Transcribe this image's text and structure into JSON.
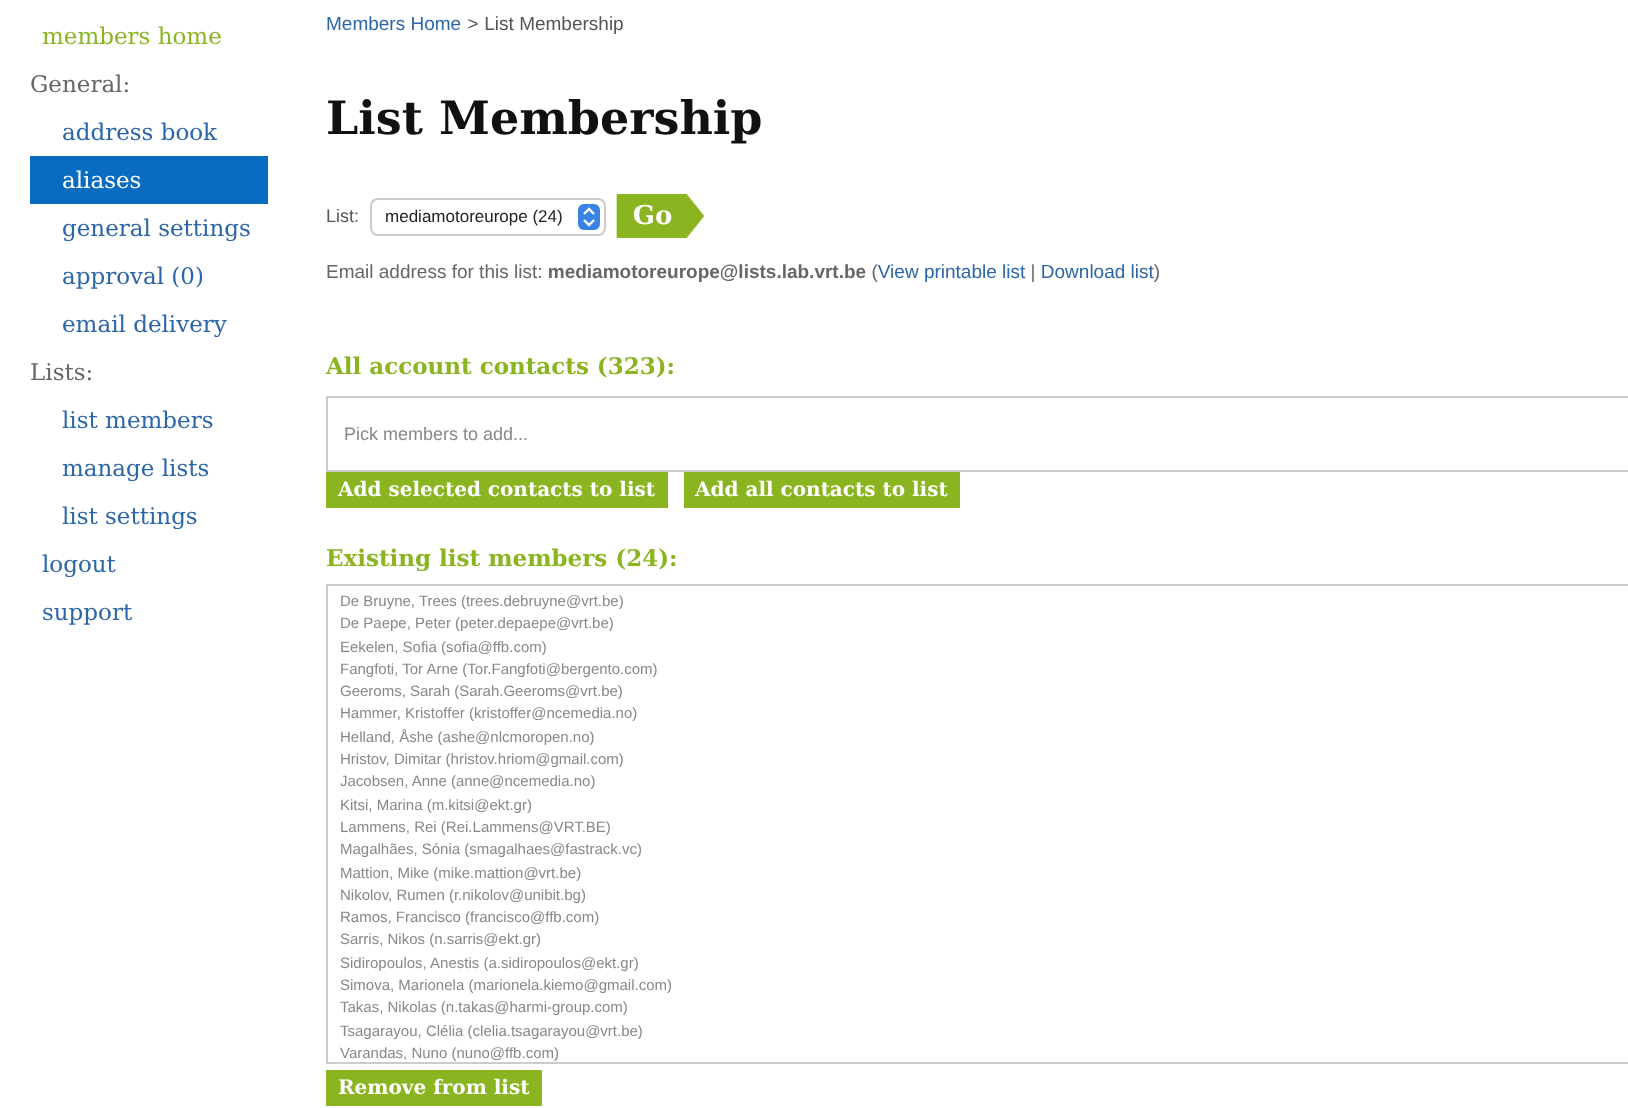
{
  "sidebar": {
    "items": [
      {
        "label": "members home",
        "kind": "home",
        "selected": false
      },
      {
        "label": "General:",
        "kind": "heading",
        "selected": false
      },
      {
        "label": "address book",
        "kind": "sub",
        "selected": false
      },
      {
        "label": "aliases",
        "kind": "sub",
        "selected": true
      },
      {
        "label": "general settings",
        "kind": "sub",
        "selected": false
      },
      {
        "label": "approval (0)",
        "kind": "sub",
        "selected": false
      },
      {
        "label": "email delivery",
        "kind": "sub",
        "selected": false
      },
      {
        "label": "Lists:",
        "kind": "heading",
        "selected": false
      },
      {
        "label": "list members",
        "kind": "sub",
        "selected": false
      },
      {
        "label": "manage lists",
        "kind": "sub",
        "selected": false
      },
      {
        "label": "list settings",
        "kind": "sub",
        "selected": false
      },
      {
        "label": "logout",
        "kind": "top",
        "selected": false
      },
      {
        "label": "support",
        "kind": "top",
        "selected": false
      }
    ]
  },
  "breadcrumb": {
    "link": "Members Home",
    "separator": ">",
    "current": "List Membership"
  },
  "title": "List Membership",
  "list_picker": {
    "label": "List:",
    "value": "mediamotoreurope (24)",
    "button": "Go"
  },
  "email_line": {
    "text": "Email address for this list: **mediamotoreurope@lists.lab.vrt.be** (",
    "links": [
      "View printable list",
      "Download list"
    ],
    "separator": "|",
    "close": ")"
  },
  "all_contacts": {
    "heading": "All account contacts (323):",
    "placeholder": "Pick members to add...",
    "buttons": [
      "Add selected contacts to list",
      "Add all contacts to list"
    ]
  },
  "existing": {
    "heading": "Existing list members (24):",
    "members": [
      "De Bruyne, Trees (trees.debruyne@vrt.be)",
      "De Paepe, Peter (peter.depaepe@vrt.be)",
      "Eekelen, Sofia (sofia@ffb.com)",
      "Fangfoti, Tor Arne (Tor.Fangfoti@bergento.com)",
      "Geeroms, Sarah (Sarah.Geeroms@vrt.be)",
      "Hammer, Kristoffer (kristoffer@ncemedia.no)",
      "Helland, Åshe (ashe@nlcmoropen.no)",
      "Hristov, Dimitar (hristov.hriom@gmail.com)",
      "Jacobsen, Anne (anne@ncemedia.no)",
      "Kitsi, Marina (m.kitsi@ekt.gr)",
      "Lammens, Rei (Rei.Lammens@VRT.BE)",
      "Magalhães, Sónia (smagalhaes@fastrack.vc)",
      "Mattion, Mike (mike.mattion@vrt.be)",
      "Nikolov, Rumen (r.nikolov@unibit.bg)",
      "Ramos, Francisco (francisco@ffb.com)",
      "Sarris, Nikos (n.sarris@ekt.gr)",
      "Sidiropoulos, Anestis (a.sidiropoulos@ekt.gr)",
      "Simova, Marionela (marionela.kiemo@gmail.com)",
      "Takas, Nikolas (n.takas@harmi-group.com)",
      "Tsagarayou, Clélia (clelia.tsagarayou@vrt.be)",
      "Varandas, Nuno (nuno@ffb.com)"
    ],
    "button": "Remove from list"
  }
}
